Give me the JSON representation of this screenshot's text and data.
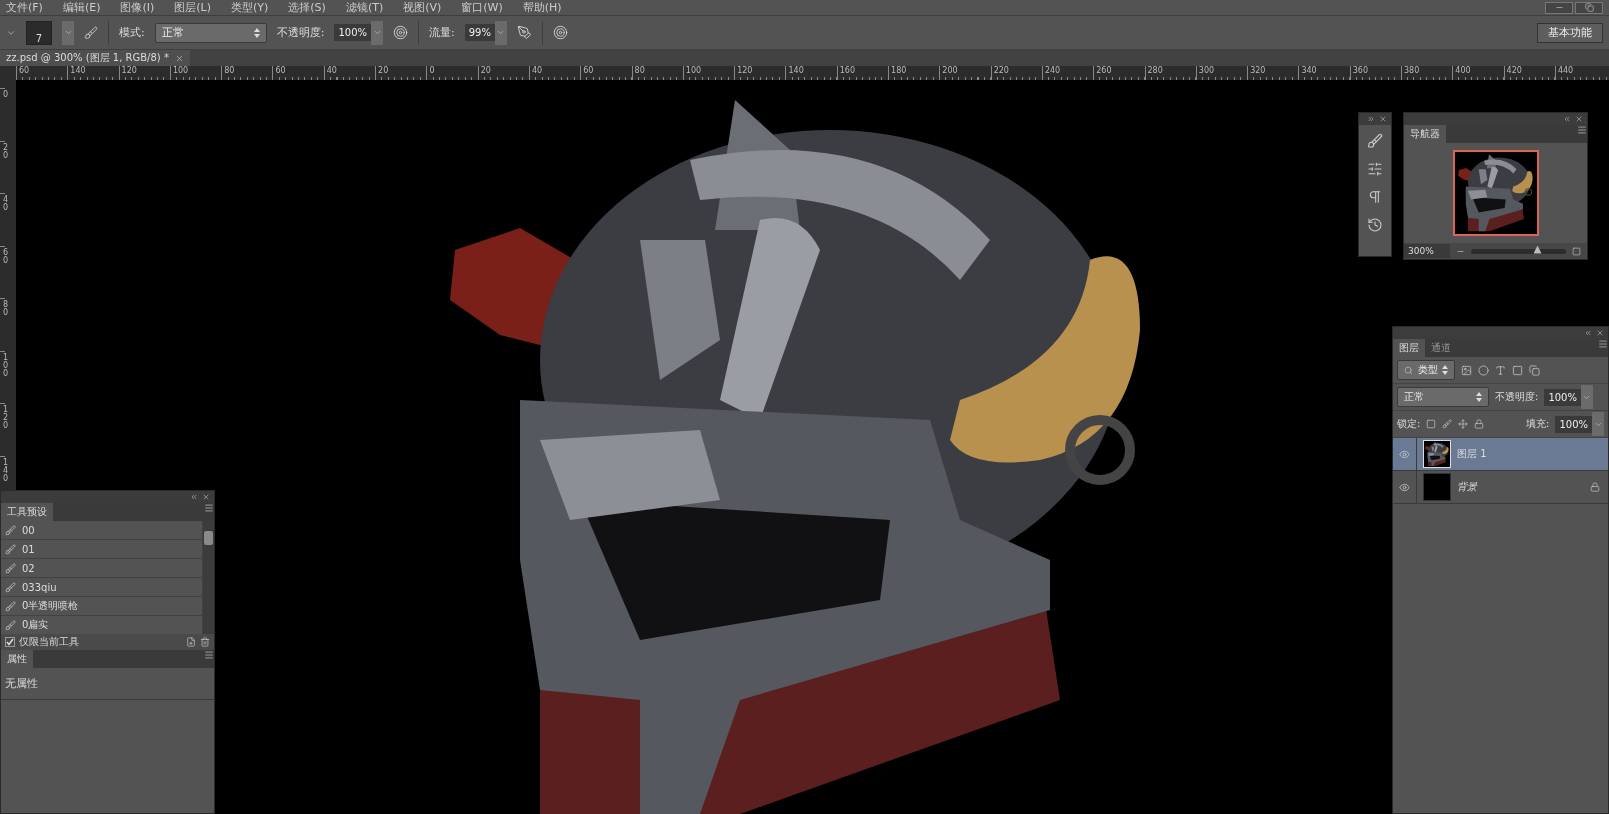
{
  "menu": [
    "文件(F)",
    "编辑(E)",
    "图像(I)",
    "图层(L)",
    "类型(Y)",
    "选择(S)",
    "滤镜(T)",
    "视图(V)",
    "窗口(W)",
    "帮助(H)"
  ],
  "options_bar": {
    "brush_size": "7",
    "mode_label": "模式:",
    "mode": "正常",
    "opacity_label": "不透明度:",
    "opacity": "100%",
    "flow_label": "流量:",
    "flow": "99%",
    "workspace": "基本功能"
  },
  "document_tab": {
    "title": "zz.psd @ 300% (图层 1, RGB/8) *",
    "selected": true
  },
  "rulers": {
    "horizontal": [
      "60",
      "140",
      "120",
      "100",
      "80",
      "60",
      "40",
      "20",
      "0",
      "20",
      "40",
      "60",
      "80",
      "100",
      "120",
      "140",
      "160",
      "180",
      "200",
      "220",
      "240",
      "260",
      "280",
      "300",
      "320",
      "340",
      "360",
      "380",
      "400",
      "420",
      "440"
    ],
    "vertical": [
      "0",
      "20",
      "40",
      "60",
      "80",
      "100",
      "120",
      "140"
    ]
  },
  "tool_presets": {
    "title": "工具预设",
    "items": [
      {
        "name": "00",
        "selected": false
      },
      {
        "name": "01",
        "selected": false
      },
      {
        "name": "02",
        "selected": false
      },
      {
        "name": "033qiu",
        "selected": false
      },
      {
        "name": "0半透明喷枪",
        "selected": false
      },
      {
        "name": "0扁实",
        "selected": false
      }
    ],
    "current_tool_only": {
      "label": "仅限当前工具",
      "checked": true
    }
  },
  "properties": {
    "title": "属性",
    "text": "无属性"
  },
  "navigator": {
    "title": "导航器",
    "zoom": "300%",
    "level": 0.7
  },
  "layers_panel": {
    "tabs": [
      {
        "label": "图层",
        "selected": true
      },
      {
        "label": "通道",
        "selected": false
      }
    ],
    "filter": "类型",
    "blend_mode": "正常",
    "opacity_label": "不透明度:",
    "opacity": "100%",
    "lock_label": "锁定:",
    "fill_label": "填充:",
    "fill": "100%",
    "layers": [
      {
        "name": "图层 1",
        "kind": "painting",
        "visible": true,
        "selected": true,
        "locked": false
      },
      {
        "name": "背景",
        "kind": "background",
        "visible": true,
        "selected": false,
        "locked": true
      }
    ]
  }
}
